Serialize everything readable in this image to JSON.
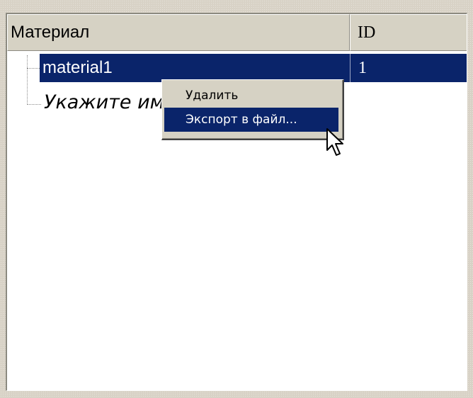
{
  "table": {
    "columns": [
      {
        "label": "Материал"
      },
      {
        "label": "ID"
      }
    ],
    "rows": [
      {
        "name": "material1",
        "id": "1",
        "selected": true
      }
    ],
    "placeholder_row": "Укажите им"
  },
  "context_menu": {
    "items": [
      {
        "label": "Удалить",
        "highlighted": false
      },
      {
        "label": "Экспорт в файл...",
        "highlighted": true
      }
    ]
  },
  "colors": {
    "selection": "#0a246a",
    "face": "#d6d2c4"
  },
  "icons": {
    "cursor": "arrow-cursor-icon"
  }
}
